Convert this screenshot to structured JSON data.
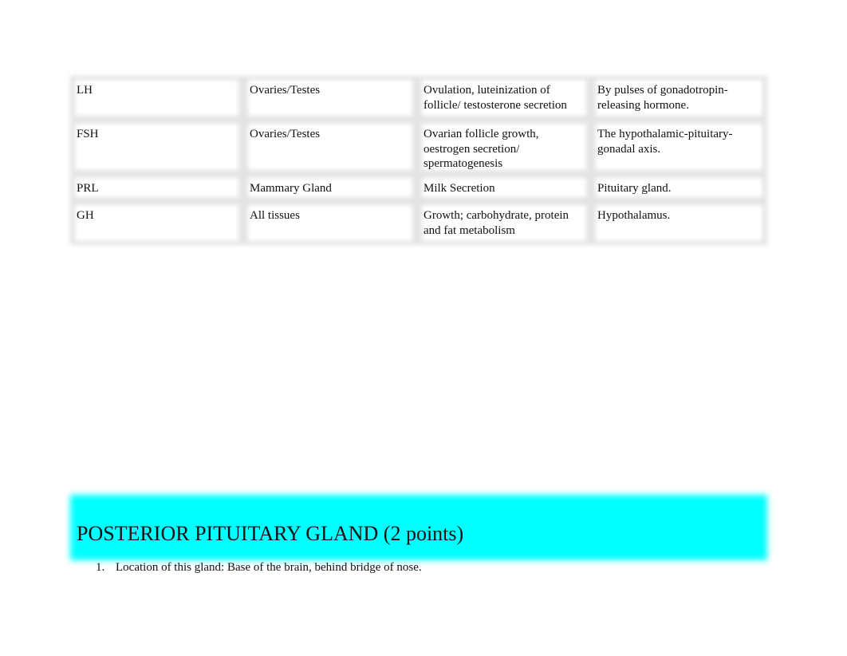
{
  "table": {
    "rows": [
      [
        "LH",
        "Ovaries/Testes",
        "Ovulation, luteinization of follicle/ testosterone secretion",
        "By pulses of gonadotropin-releasing hormone."
      ],
      [
        "FSH",
        "Ovaries/Testes",
        "Ovarian follicle growth, oestrogen secretion/ spermatogenesis",
        "The hypothalamic-pituitary-gonadal axis."
      ],
      [
        "PRL",
        "Mammary Gland",
        "Milk Secretion",
        "Pituitary gland."
      ],
      [
        "GH",
        "All tissues",
        "Growth; carbohydrate, protein and fat metabolism",
        "Hypothalamus."
      ]
    ]
  },
  "section": {
    "heading": "POSTERIOR PITUITARY GLAND (2 points)",
    "heading_bg": "#00ffff",
    "items": [
      {
        "number": "1.",
        "text": "Location of this gland: Base of the brain, behind bridge of nose."
      }
    ]
  }
}
